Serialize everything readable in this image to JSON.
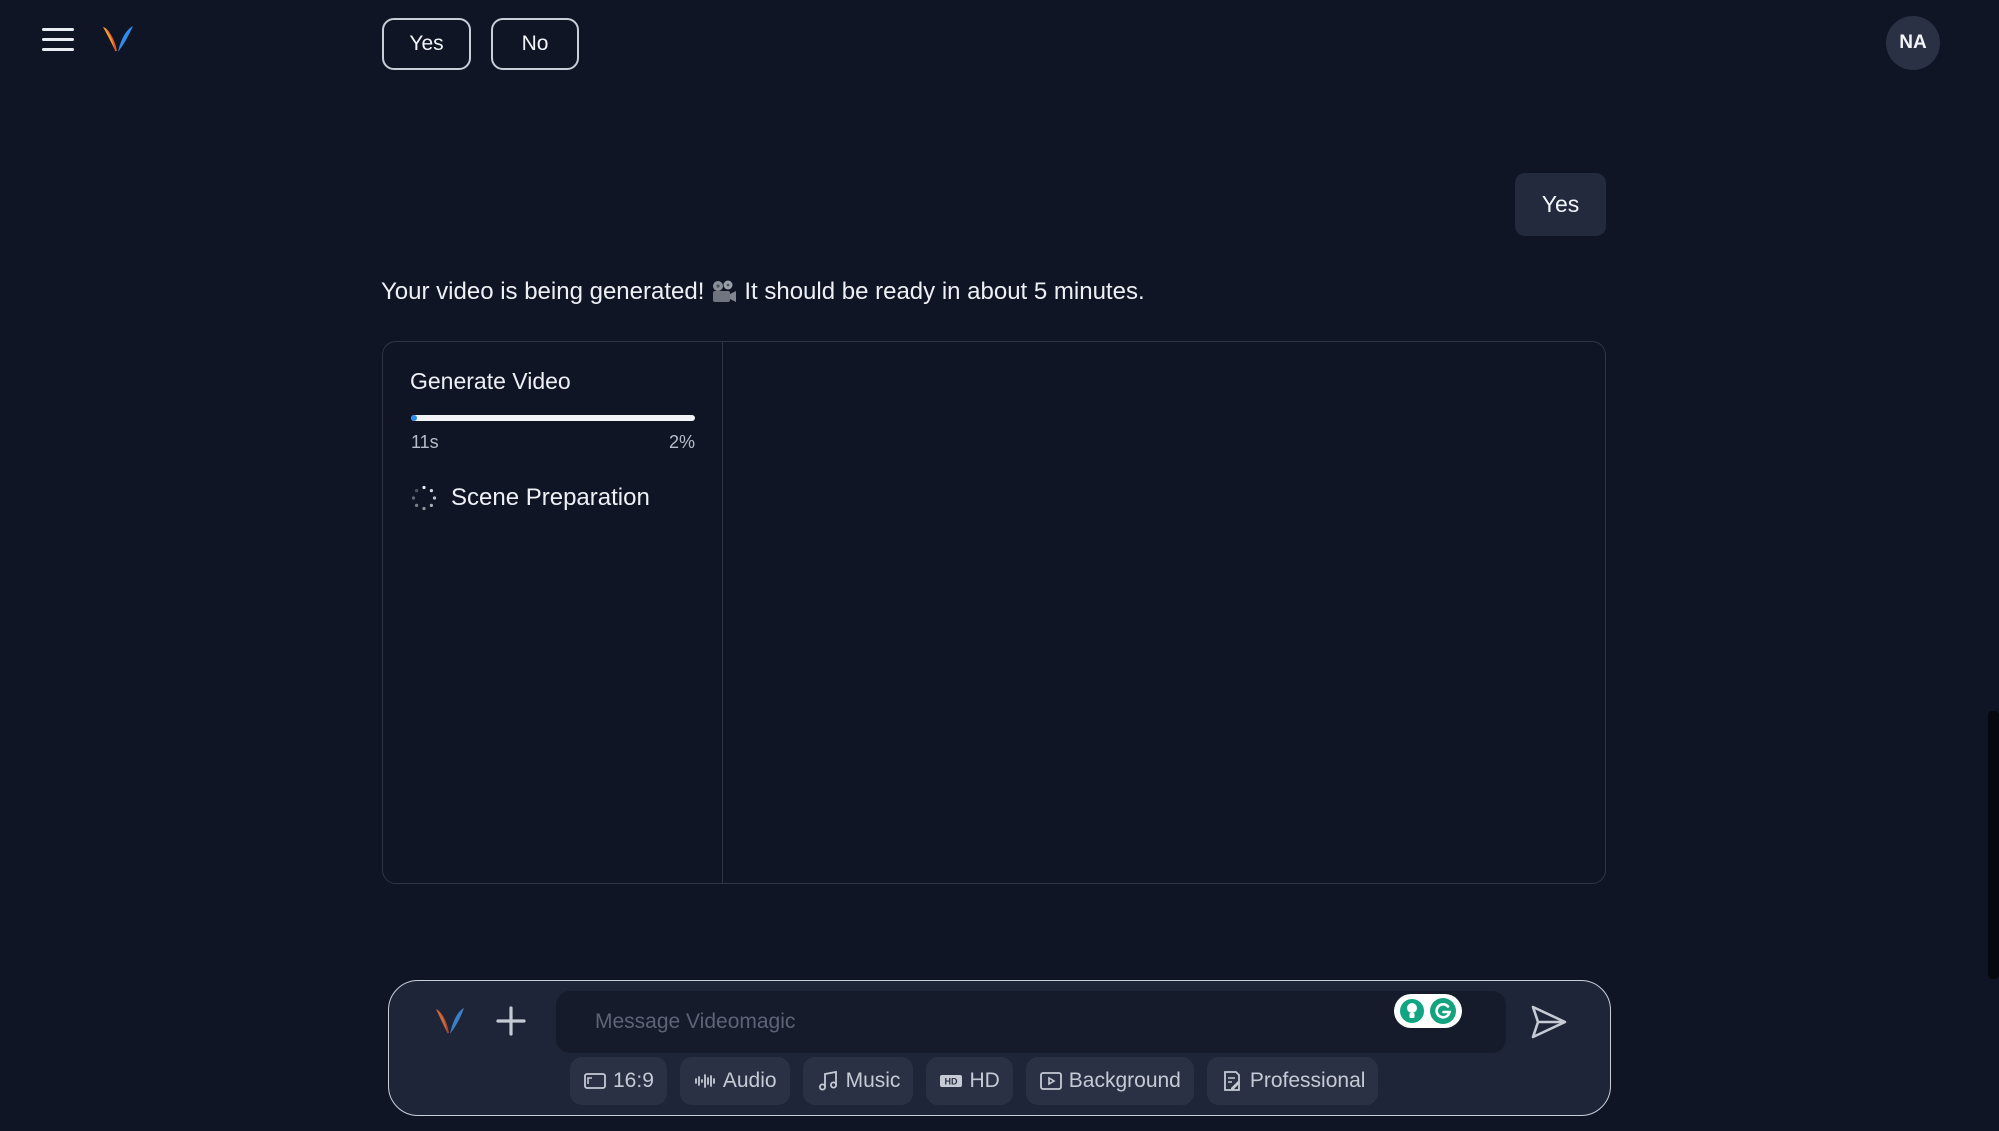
{
  "header": {
    "avatar_initials": "NA",
    "logo_icon": "videomagic-logo-icon",
    "menu_icon": "hamburger-menu-icon"
  },
  "quick_replies": {
    "yes": "Yes",
    "no": "No"
  },
  "chat": {
    "user_message": "Yes",
    "assistant_message_part1": "Your video is being generated!",
    "assistant_message_part2": "It should be ready in about 5 minutes.",
    "assistant_icon": "movie-camera-icon"
  },
  "generate_panel": {
    "title": "Generate Video",
    "elapsed": "11s",
    "percent_label": "2%",
    "progress": 0.02,
    "step_label": "Scene Preparation",
    "step_icon": "loading-spinner-icon"
  },
  "composer": {
    "placeholder": "Message Videomagic",
    "chips": {
      "aspect": "16:9",
      "audio": "Audio",
      "music": "Music",
      "hd": "HD",
      "background": "Background",
      "professional": "Professional"
    }
  },
  "colors": {
    "background": "#0f1524",
    "progress_fill": "#2a8bf2",
    "panel_border": "#2e3548",
    "chip_bg": "#2a3145"
  }
}
